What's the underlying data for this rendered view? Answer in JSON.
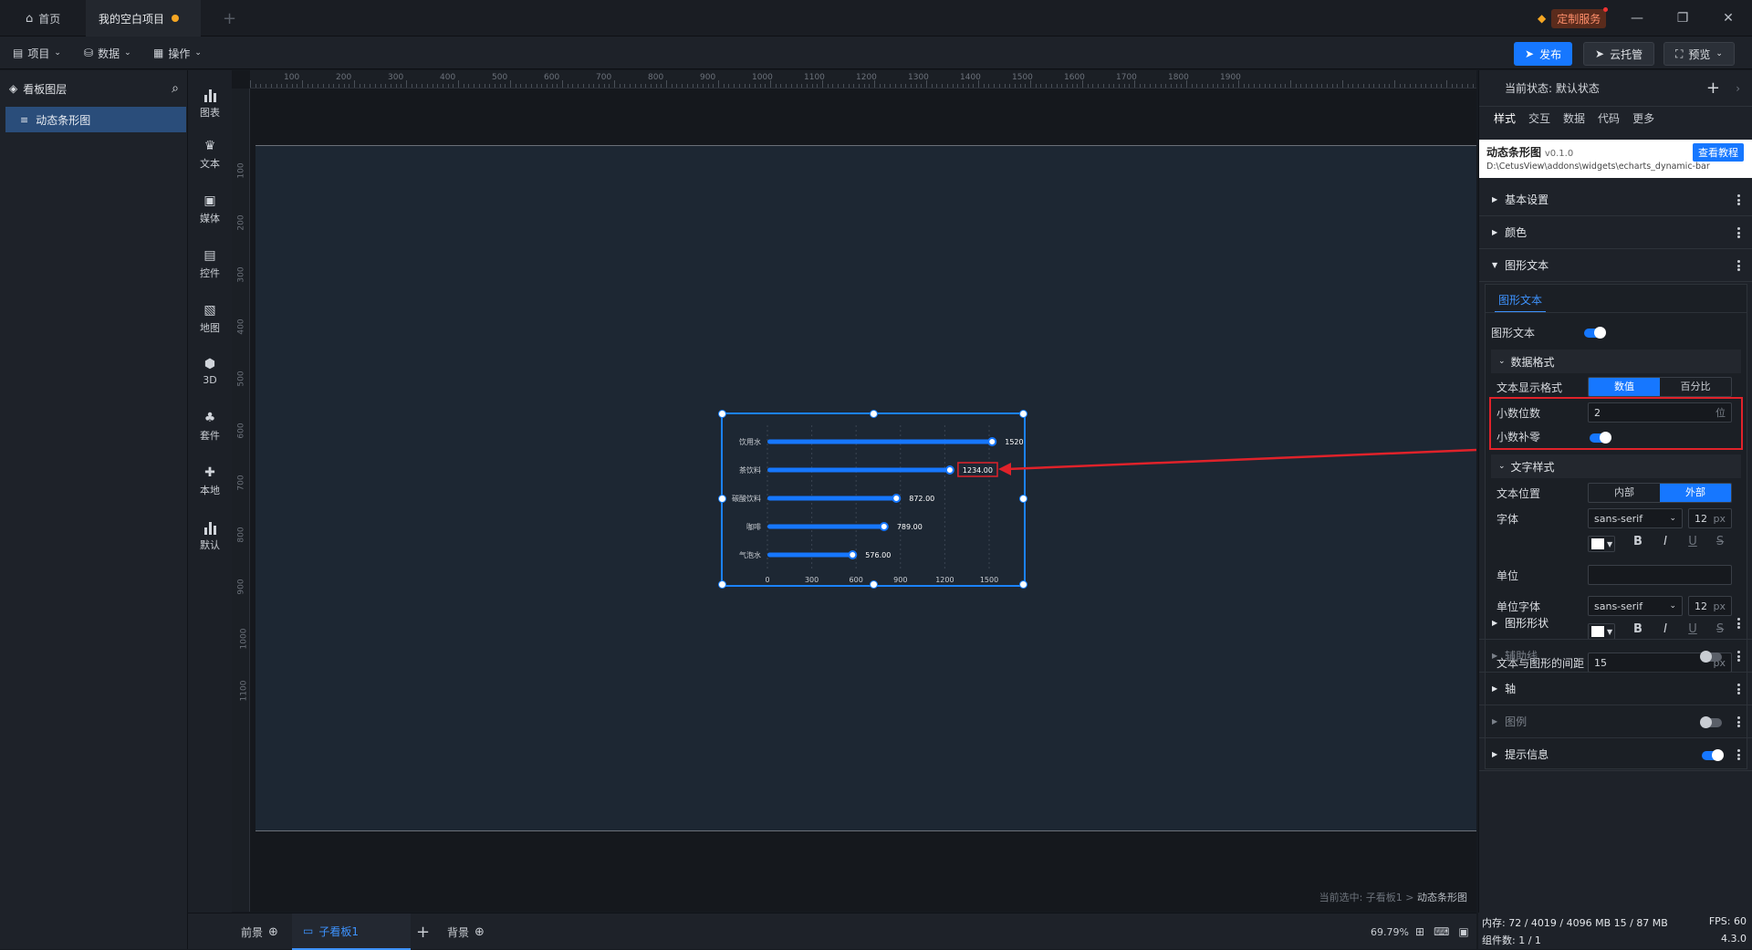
{
  "titlebar": {
    "home_tab": "首页",
    "project_tab": "我的空白项目",
    "custom_service": "定制服务"
  },
  "toolbar": {
    "menu_project": "项目",
    "menu_data": "数据",
    "menu_operate": "操作",
    "publish": "发布",
    "cloud": "云托管",
    "preview": "预览"
  },
  "layers": {
    "title": "看板图层",
    "items": [
      {
        "label": "动态条形图"
      }
    ]
  },
  "rail": [
    {
      "label": "图表",
      "icon": "bar-chart-icon"
    },
    {
      "label": "文本",
      "icon": "text-crown-icon"
    },
    {
      "label": "媒体",
      "icon": "media-icon"
    },
    {
      "label": "控件",
      "icon": "control-icon"
    },
    {
      "label": "地图",
      "icon": "map-icon"
    },
    {
      "label": "3D",
      "icon": "cube-icon"
    },
    {
      "label": "套件",
      "icon": "kit-icon"
    },
    {
      "label": "本地",
      "icon": "puzzle-icon"
    },
    {
      "label": "默认",
      "icon": "default-chart-icon"
    }
  ],
  "ruler": {
    "top": [
      "100",
      "200",
      "300",
      "400",
      "500",
      "600",
      "700",
      "800",
      "900",
      "1000",
      "1100",
      "1200",
      "1300",
      "1400",
      "1500",
      "1600",
      "1700",
      "1800",
      "1900"
    ],
    "left": [
      "100",
      "200",
      "300",
      "400",
      "500",
      "600",
      "700",
      "800",
      "900",
      "1000",
      "1100"
    ]
  },
  "canvas": {
    "status_prefix": "当前选中: 子看板1 > ",
    "status_current": "动态条形图"
  },
  "chart_data": {
    "type": "bar",
    "orientation": "horizontal",
    "categories": [
      "饮用水",
      "茶饮料",
      "碳酸饮料",
      "咖啡",
      "气泡水"
    ],
    "values": [
      1520.0,
      1234.0,
      872.0,
      789.0,
      576.0
    ],
    "value_labels": [
      "1520.0",
      "1234.00",
      "872.00",
      "789.00",
      "576.00"
    ],
    "x_ticks": [
      "0",
      "300",
      "600",
      "900",
      "1200",
      "1500"
    ],
    "xlim": [
      0,
      1500
    ],
    "bar_color": "#1677ff",
    "highlighted_label_index": 1
  },
  "bottombar": {
    "front": "前景",
    "sub_board": "子看板1",
    "background": "背景",
    "zoom": "69.79%"
  },
  "rpanel": {
    "state_label": "当前状态: 默认状态",
    "tabs": [
      "样式",
      "交互",
      "数据",
      "代码",
      "更多"
    ],
    "widget_name": "动态条形图",
    "widget_version": "v0.1.0",
    "widget_path": "D:\\CetusView\\addons\\widgets\\echarts_dynamic-bar",
    "tutorial_button": "查看教程",
    "sections": {
      "basic": "基本设置",
      "color": "颜色",
      "graphic_text": "图形文本",
      "graphic_shape": "图形形状",
      "guide_line": "辅助线",
      "axis": "轴",
      "legend": "图例",
      "tooltip": "提示信息"
    },
    "graphic_text_tab": "图形文本",
    "graphic_text_toggle_label": "图形文本",
    "data_format": {
      "title": "数据格式",
      "display_label": "文本显示格式",
      "display_options": [
        "数值",
        "百分比"
      ],
      "decimals_label": "小数位数",
      "decimals_value": "2",
      "decimals_unit": "位",
      "pad_zero_label": "小数补零"
    },
    "text_style": {
      "title": "文字样式",
      "position_label": "文本位置",
      "position_options": [
        "内部",
        "外部"
      ],
      "font_label": "字体",
      "font_value": "sans-serif",
      "font_size": "12",
      "unit_px": "px",
      "unit_label": "单位",
      "unit_font_label": "单位字体",
      "unit_font_value": "sans-serif",
      "unit_font_size": "12",
      "gap_label": "文本与图形的间距",
      "gap_value": "15"
    }
  },
  "footer": {
    "memory": "内存: 72 / 4019 / 4096 MB 15 / 87 MB",
    "fps": "FPS: 60",
    "components": "组件数: 1 / 1",
    "version": "4.3.0"
  }
}
